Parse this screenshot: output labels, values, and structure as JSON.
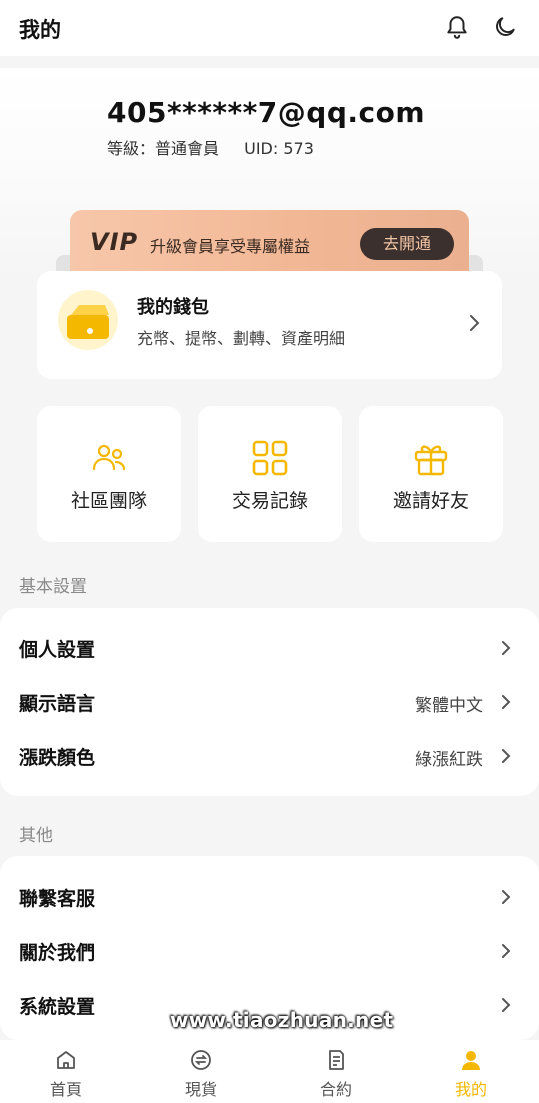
{
  "header": {
    "title": "我的",
    "icons": [
      "bell-icon",
      "moon-icon"
    ]
  },
  "profile": {
    "account": "405******7@qq.com",
    "level": "等級：普通會員",
    "uid": "UID: 573"
  },
  "vip": {
    "logo": "VIP",
    "text": "升級會員享受專屬權益",
    "button": "去開通"
  },
  "wallet": {
    "title": "我的錢包",
    "subtitle": "充幣、提幣、劃轉、資產明細",
    "icon": "wallet-icon"
  },
  "tiles": [
    {
      "label": "社區團隊",
      "icon": "team-icon"
    },
    {
      "label": "交易記錄",
      "icon": "grid-icon"
    },
    {
      "label": "邀請好友",
      "icon": "gift-icon"
    }
  ],
  "basic_settings": {
    "section": "基本設置",
    "items": [
      {
        "label": "個人設置",
        "value": ""
      },
      {
        "label": "顯示語言",
        "value": "繁體中文"
      },
      {
        "label": "漲跌顏色",
        "value": "綠漲紅跌"
      }
    ]
  },
  "other": {
    "section": "其他",
    "items": [
      {
        "label": "聯繫客服"
      },
      {
        "label": "關於我們"
      },
      {
        "label": "系統設置"
      }
    ]
  },
  "watermark": "www.tiaozhuan.net",
  "tabbar": [
    {
      "label": "首頁",
      "icon": "home-icon"
    },
    {
      "label": "現貨",
      "icon": "exchange-icon"
    },
    {
      "label": "合約",
      "icon": "contract-icon"
    },
    {
      "label": "我的",
      "icon": "user-icon",
      "active": true
    }
  ],
  "colors": {
    "accent": "#f5b800",
    "vip_bg": "#f2b896",
    "vip_button": "#3b302d"
  }
}
